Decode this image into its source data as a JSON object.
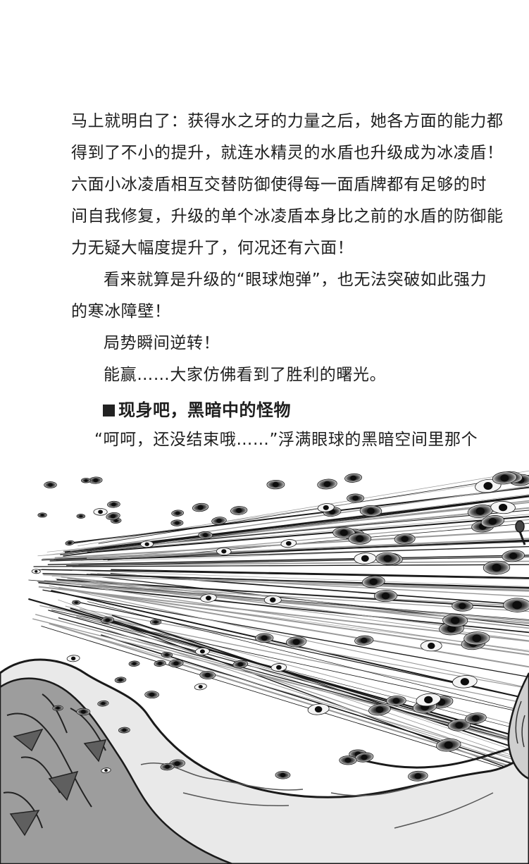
{
  "paragraphs": [
    {
      "lines": [
        "马上就明白了：获得水之牙的力量之后，她各方面的能力都",
        "得到了不小的提升，就连水精灵的水盾也升级成为冰凌盾！",
        "六面小冰凌盾相互交替防御使得每一面盾牌都有足够的时",
        "间自我修复，升级的单个冰凌盾本身比之前的水盾的防御能",
        "力无疑大幅度提升了，何况还有六面！"
      ]
    },
    {
      "lines": [
        "看来就算是升级的“眼球炮弹”，也无法突破如此强力",
        "的寒冰障壁！"
      ]
    },
    {
      "lines": [
        "局势瞬间逆转！"
      ]
    },
    {
      "lines": [
        "能赢……大家仿佛看到了胜利的曙光。"
      ]
    }
  ],
  "section_heading": "现身吧，黑暗中的怪物",
  "after_heading_line": "“呵呵，还没结束哦……”浮满眼球的黑暗空间里那个",
  "illustration": {
    "subject": "eyeballs-flying-over-rocky-ground-manga",
    "colors": {
      "ink": "#1a1a1a",
      "midgray": "#8a8a8a",
      "lightgray": "#cfcfcf"
    }
  }
}
